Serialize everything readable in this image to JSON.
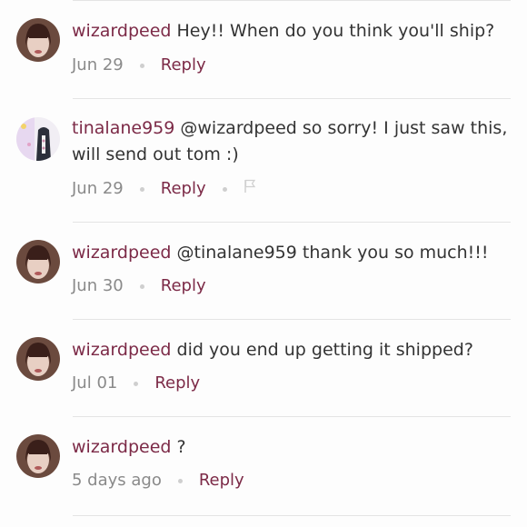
{
  "comments": [
    {
      "username": "wizardpeed",
      "text": " Hey!! When do you think you'll ship?",
      "date": "Jun 29",
      "reply_label": "Reply"
    },
    {
      "username": "tinalane959",
      "text": " @wizardpeed so sorry! I just saw this, will send out tom :)",
      "date": "Jun 29",
      "reply_label": "Reply"
    },
    {
      "username": "wizardpeed",
      "text": " @tinalane959 thank you so much!!!",
      "date": "Jun 30",
      "reply_label": "Reply"
    },
    {
      "username": "wizardpeed",
      "text": " did you end up getting it shipped?",
      "date": "Jul 01",
      "reply_label": "Reply"
    },
    {
      "username": "wizardpeed",
      "text": " ?",
      "date": "5 days ago",
      "reply_label": "Reply"
    }
  ],
  "colors": {
    "username": "#7c2a47",
    "reply": "#7c2a47",
    "meta": "#8a8a8a",
    "divider": "#e4e4e4"
  },
  "icons": {
    "flag": "flag-icon"
  }
}
